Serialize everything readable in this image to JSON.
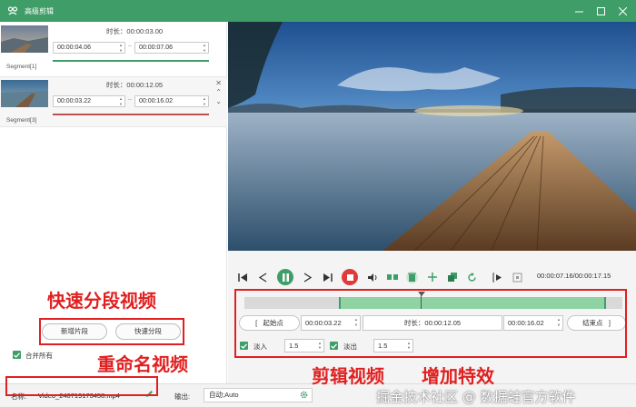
{
  "window": {
    "title": "高级剪辑"
  },
  "segments": [
    {
      "name": "Segment[1]",
      "duration": "时长：00:00:03.00",
      "start": "00:00:04.06",
      "end": "00:00:07.06"
    },
    {
      "name": "Segment[3]",
      "duration": "时长：00:00:12.05",
      "start": "00:00:03.22",
      "end": "00:00:16.02"
    }
  ],
  "left": {
    "add_segment": "新增片段",
    "quick_split": "快速分段",
    "merge_all": "合并所有"
  },
  "annotations": {
    "split": "快速分段视频",
    "rename": "重命名视频",
    "trim": "剪辑视频",
    "effects": "增加特效"
  },
  "bottom": {
    "name_label": "名称:",
    "name_value": "Video_240719173458.mp4",
    "output_label": "输出:",
    "output_value": "自动;Auto",
    "watermark": "掘金技术社区 @ 数据蛙官方软件"
  },
  "player": {
    "timecode": "00:00:07.16/00:00:17.15"
  },
  "trim": {
    "start_label": "起始点",
    "start_bracket": "[",
    "start_value": "00:00:03.22",
    "duration": "时长：00:00:12.05",
    "end_value": "00:00:16.02",
    "end_label": "结束点",
    "end_bracket": "]"
  },
  "effects": {
    "fade_in_label": "淡入",
    "fade_in_value": "1.5",
    "fade_out_label": "淡出",
    "fade_out_value": "1.5"
  },
  "colors": {
    "accent": "#3f9e68",
    "annotation": "#e02020",
    "stop": "#e03b3b"
  }
}
